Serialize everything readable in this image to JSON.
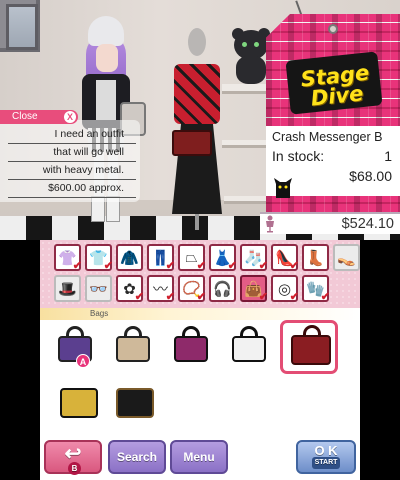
{
  "dialog": {
    "close_label": "Close",
    "close_button": "X",
    "lines": [
      "I need an outfit",
      "that will go well",
      "with heavy metal.",
      "$600.00 approx."
    ]
  },
  "store": {
    "logo_line1": "Stage",
    "logo_line2": "Dive",
    "item_name": "Crash Messenger B",
    "stock_label": "In stock:",
    "stock_value": "1",
    "price": "$68.00",
    "total": "$524.10"
  },
  "categories": [
    {
      "icon": "top-icon",
      "glyph": "👚",
      "checked": true,
      "state": "normal"
    },
    {
      "icon": "shirt-icon",
      "glyph": "👕",
      "checked": true,
      "state": "normal"
    },
    {
      "icon": "jacket-icon",
      "glyph": "🧥",
      "checked": false,
      "state": "normal"
    },
    {
      "icon": "pants-icon",
      "glyph": "👖",
      "checked": true,
      "state": "normal"
    },
    {
      "icon": "skirt-icon",
      "glyph": "⏢",
      "checked": true,
      "state": "normal"
    },
    {
      "icon": "dress-icon",
      "glyph": "👗",
      "checked": true,
      "state": "normal"
    },
    {
      "icon": "socks-icon",
      "glyph": "🧦",
      "checked": true,
      "state": "normal"
    },
    {
      "icon": "shoes-icon",
      "glyph": "👠",
      "checked": true,
      "state": "normal"
    },
    {
      "icon": "boots-icon",
      "glyph": "👢",
      "checked": false,
      "state": "normal"
    },
    {
      "icon": "sandals-icon",
      "glyph": "👡",
      "checked": false,
      "state": "dim"
    },
    {
      "icon": "hat-icon",
      "glyph": "🎩",
      "checked": false,
      "state": "dim"
    },
    {
      "icon": "glasses-icon",
      "glyph": "👓",
      "checked": false,
      "state": "dim"
    },
    {
      "icon": "hair-accessory-icon",
      "glyph": "✿",
      "checked": true,
      "state": "normal"
    },
    {
      "icon": "scarf-icon",
      "glyph": "〰",
      "checked": true,
      "state": "normal"
    },
    {
      "icon": "necklace-icon",
      "glyph": "📿",
      "checked": true,
      "state": "normal"
    },
    {
      "icon": "earmuffs-icon",
      "glyph": "🎧",
      "checked": false,
      "state": "normal"
    },
    {
      "icon": "bag-icon",
      "glyph": "👜",
      "checked": true,
      "state": "sel"
    },
    {
      "icon": "bracelet-icon",
      "glyph": "◎",
      "checked": true,
      "state": "normal"
    },
    {
      "icon": "gloves-icon",
      "glyph": "🧤",
      "checked": true,
      "state": "normal"
    }
  ],
  "items_label": "Bags",
  "bags": [
    {
      "name": "purple-plaid-tote",
      "color": "#5b3f8f",
      "accent": "#222"
    },
    {
      "name": "star-tote",
      "color": "#cfb99a",
      "accent": "#222"
    },
    {
      "name": "magenta-plaid-bag",
      "color": "#8e2a6a",
      "accent": "#111"
    },
    {
      "name": "checkered-bag",
      "color": "#f2f2f2",
      "accent": "#111"
    },
    {
      "name": "crash-messenger-bag",
      "color": "#8a1d22",
      "accent": "#3a0a0a"
    },
    {
      "name": "studded-clutch",
      "color": "#d8b23a",
      "accent": "#111"
    },
    {
      "name": "black-case",
      "color": "#1a1a1a",
      "accent": "#7a5a2a"
    }
  ],
  "buttons": {
    "back_badge": "B",
    "search": "Search",
    "menu": "Menu",
    "ok": "O K",
    "ok_sub": "START"
  },
  "cursor_badge": "A"
}
